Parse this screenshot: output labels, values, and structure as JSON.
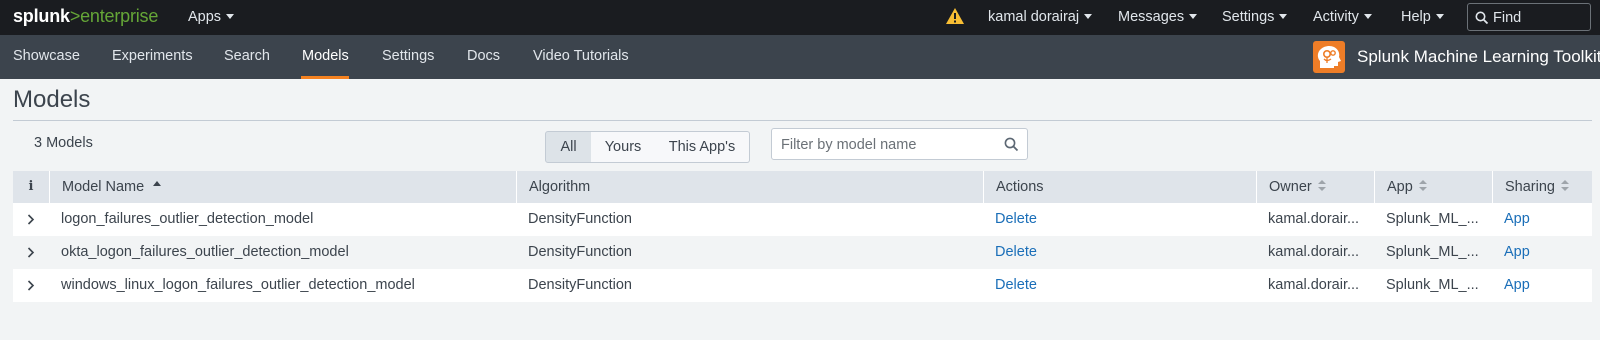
{
  "topbar": {
    "logo_main": "splunk",
    "logo_sep": ">",
    "logo_product": "enterprise",
    "apps_label": "Apps",
    "user_label": "kamal dorairaj",
    "messages_label": "Messages",
    "settings_label": "Settings",
    "activity_label": "Activity",
    "help_label": "Help",
    "find_placeholder": "Find",
    "warning_icon": "warning-triangle-icon",
    "warning_color": "#f8be34"
  },
  "appbar": {
    "nav": [
      "Showcase",
      "Experiments",
      "Search",
      "Models",
      "Settings",
      "Docs",
      "Video Tutorials"
    ],
    "active": "Models",
    "active_color": "#f58220",
    "app_title": "Splunk Machine Learning Toolkit",
    "app_icon": "ml-brain-icon"
  },
  "page": {
    "title": "Models",
    "count_label": "3 Models",
    "filter_tabs": [
      "All",
      "Yours",
      "This App's"
    ],
    "selected_filter": "All",
    "filter_placeholder": "Filter by model name"
  },
  "table": {
    "info_header": "i",
    "columns": [
      "Model Name",
      "Algorithm",
      "Actions",
      "Owner",
      "App",
      "Sharing"
    ],
    "sorted_column": "Model Name",
    "sort_direction": "ascending",
    "rows": [
      {
        "name": "logon_failures_outlier_detection_model",
        "algorithm": "DensityFunction",
        "action": "Delete",
        "owner": "kamal.dorair...",
        "app": "Splunk_ML_...",
        "sharing": "App"
      },
      {
        "name": "okta_logon_failures_outlier_detection_model",
        "algorithm": "DensityFunction",
        "action": "Delete",
        "owner": "kamal.dorair...",
        "app": "Splunk_ML_...",
        "sharing": "App"
      },
      {
        "name": "windows_linux_logon_failures_outlier_detection_model",
        "algorithm": "DensityFunction",
        "action": "Delete",
        "owner": "kamal.dorair...",
        "app": "Splunk_ML_...",
        "sharing": "App"
      }
    ]
  }
}
